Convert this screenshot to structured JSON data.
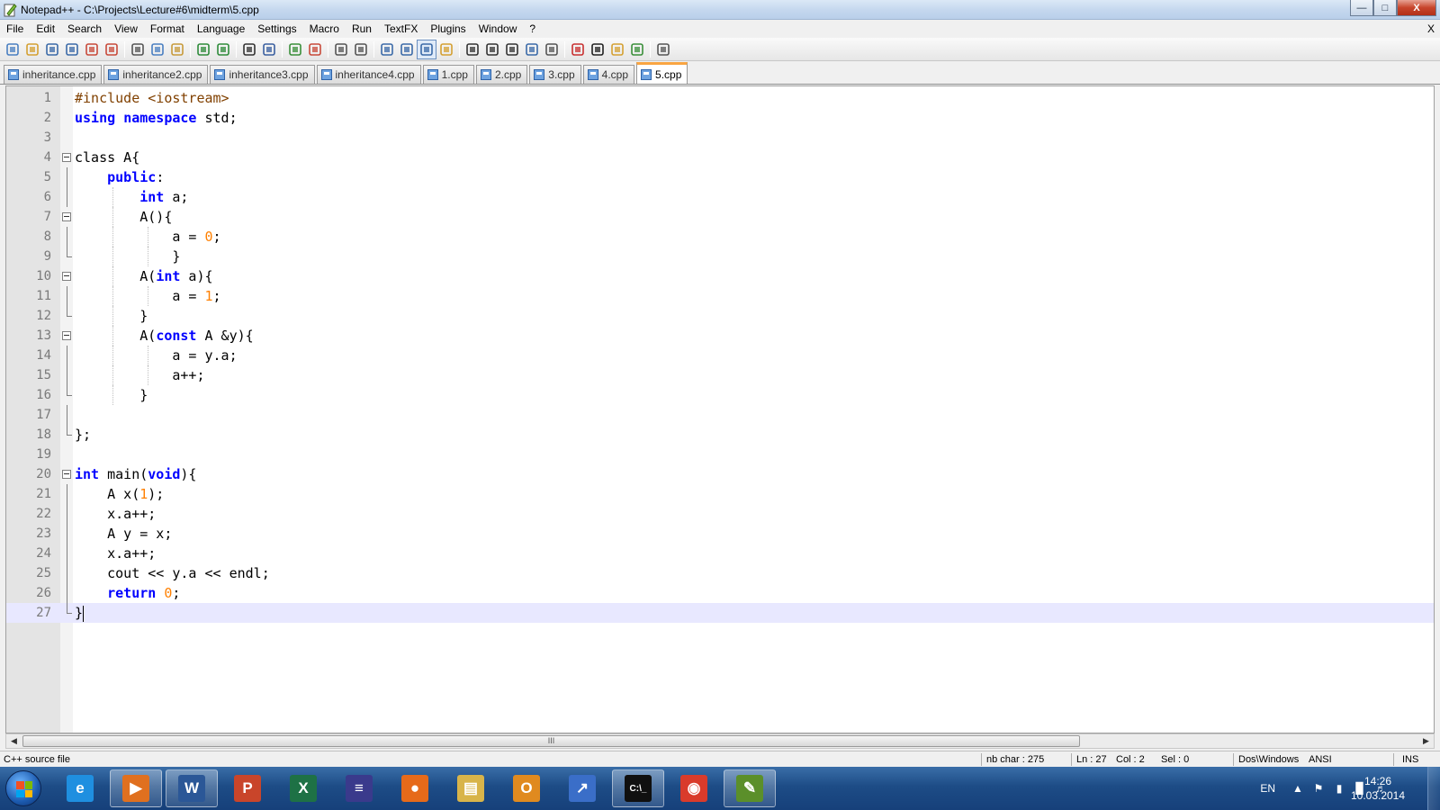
{
  "window": {
    "title": "Notepad++ - C:\\Projects\\Lecture#6\\midterm\\5.cpp",
    "controls": {
      "minimize": "—",
      "maximize": "□",
      "close": "X"
    }
  },
  "menu": {
    "items": [
      "File",
      "Edit",
      "Search",
      "View",
      "Format",
      "Language",
      "Settings",
      "Macro",
      "Run",
      "TextFX",
      "Plugins",
      "Window",
      "?"
    ],
    "close_doc": "X"
  },
  "toolbar": {
    "icons": [
      "new-file-icon",
      "open-file-icon",
      "save-icon",
      "save-all-icon",
      "close-icon",
      "close-all-icon",
      "cut-icon",
      "copy-icon",
      "paste-icon",
      "undo-icon",
      "redo-icon",
      "find-icon",
      "replace-icon",
      "zoom-in-icon",
      "zoom-out-icon",
      "sync-vertical-icon",
      "sync-horizontal-icon",
      "word-wrap-icon",
      "show-all-chars-icon",
      "indent-guide-icon",
      "user-defined-language-icon",
      "record-macro-icon",
      "stop-macro-icon",
      "play-macro-icon",
      "run-macro-multiple-icon",
      "save-macro-icon",
      "pdf-icon",
      "html-icon",
      "folder-icon",
      "spellcheck-icon",
      "print-icon"
    ]
  },
  "tabs": [
    {
      "label": "inheritance.cpp",
      "active": false
    },
    {
      "label": "inheritance2.cpp",
      "active": false
    },
    {
      "label": "inheritance3.cpp",
      "active": false
    },
    {
      "label": "inheritance4.cpp",
      "active": false
    },
    {
      "label": "1.cpp",
      "active": false
    },
    {
      "label": "2.cpp",
      "active": false
    },
    {
      "label": "3.cpp",
      "active": false
    },
    {
      "label": "4.cpp",
      "active": false
    },
    {
      "label": "5.cpp",
      "active": true
    }
  ],
  "editor": {
    "language": "C++",
    "current_line": 27,
    "lines": [
      {
        "n": "1",
        "text": "#include <iostream>"
      },
      {
        "n": "2",
        "text": "using namespace std;"
      },
      {
        "n": "3",
        "text": ""
      },
      {
        "n": "4",
        "text": "class A{"
      },
      {
        "n": "5",
        "text": "    public:"
      },
      {
        "n": "6",
        "text": "        int a;"
      },
      {
        "n": "7",
        "text": "        A(){"
      },
      {
        "n": "8",
        "text": "            a = 0;"
      },
      {
        "n": "9",
        "text": "            }"
      },
      {
        "n": "10",
        "text": "        A(int a){"
      },
      {
        "n": "11",
        "text": "            a = 1;"
      },
      {
        "n": "12",
        "text": "        }"
      },
      {
        "n": "13",
        "text": "        A(const A &y){"
      },
      {
        "n": "14",
        "text": "            a = y.a;"
      },
      {
        "n": "15",
        "text": "            a++;"
      },
      {
        "n": "16",
        "text": "        }"
      },
      {
        "n": "17",
        "text": ""
      },
      {
        "n": "18",
        "text": "};"
      },
      {
        "n": "19",
        "text": ""
      },
      {
        "n": "20",
        "text": "int main(void){"
      },
      {
        "n": "21",
        "text": "    A x(1);"
      },
      {
        "n": "22",
        "text": "    x.a++;"
      },
      {
        "n": "23",
        "text": "    A y = x;"
      },
      {
        "n": "24",
        "text": "    x.a++;"
      },
      {
        "n": "25",
        "text": "    cout << y.a << endl;"
      },
      {
        "n": "26",
        "text": "    return 0;"
      },
      {
        "n": "27",
        "text": "}"
      }
    ]
  },
  "scrollbar": {
    "grip": "III"
  },
  "status": {
    "file_type": "C++ source file",
    "nb_char": "nb char : 275",
    "ln": "Ln : 27",
    "col": "Col : 2",
    "sel": "Sel : 0",
    "eol": "Dos\\Windows",
    "encoding": "ANSI",
    "mode": "INS"
  },
  "taskbar": {
    "apps": [
      {
        "name": "internet-explorer-icon",
        "glyph": "e",
        "color": "#1f8fe0",
        "open": false
      },
      {
        "name": "media-player-icon",
        "glyph": "▶",
        "color": "#e0701f",
        "open": true
      },
      {
        "name": "word-icon",
        "glyph": "W",
        "color": "#2b5797",
        "open": true
      },
      {
        "name": "powerpoint-icon",
        "glyph": "P",
        "color": "#c9452a",
        "open": false
      },
      {
        "name": "excel-icon",
        "glyph": "X",
        "color": "#1e7145",
        "open": false
      },
      {
        "name": "visual-studio-icon",
        "glyph": "≡",
        "color": "#3a3a8c",
        "open": false
      },
      {
        "name": "firefox-icon",
        "glyph": "●",
        "color": "#e66a1a",
        "open": false
      },
      {
        "name": "file-explorer-icon",
        "glyph": "▤",
        "color": "#d8b44a",
        "open": false
      },
      {
        "name": "outlook-icon",
        "glyph": "O",
        "color": "#e08a1f",
        "open": false
      },
      {
        "name": "remote-desktop-icon",
        "glyph": "↗",
        "color": "#3a6ec8",
        "open": false
      },
      {
        "name": "command-prompt-icon",
        "glyph": "C:\\_",
        "color": "#101010",
        "open": true
      },
      {
        "name": "chrome-icon",
        "glyph": "◉",
        "color": "#d93b2b",
        "open": false
      },
      {
        "name": "notepad-plus-plus-icon",
        "glyph": "✎",
        "color": "#5b8f2a",
        "open": true
      }
    ],
    "lang": "EN",
    "time": "14:26",
    "date": "10.03.2014"
  }
}
